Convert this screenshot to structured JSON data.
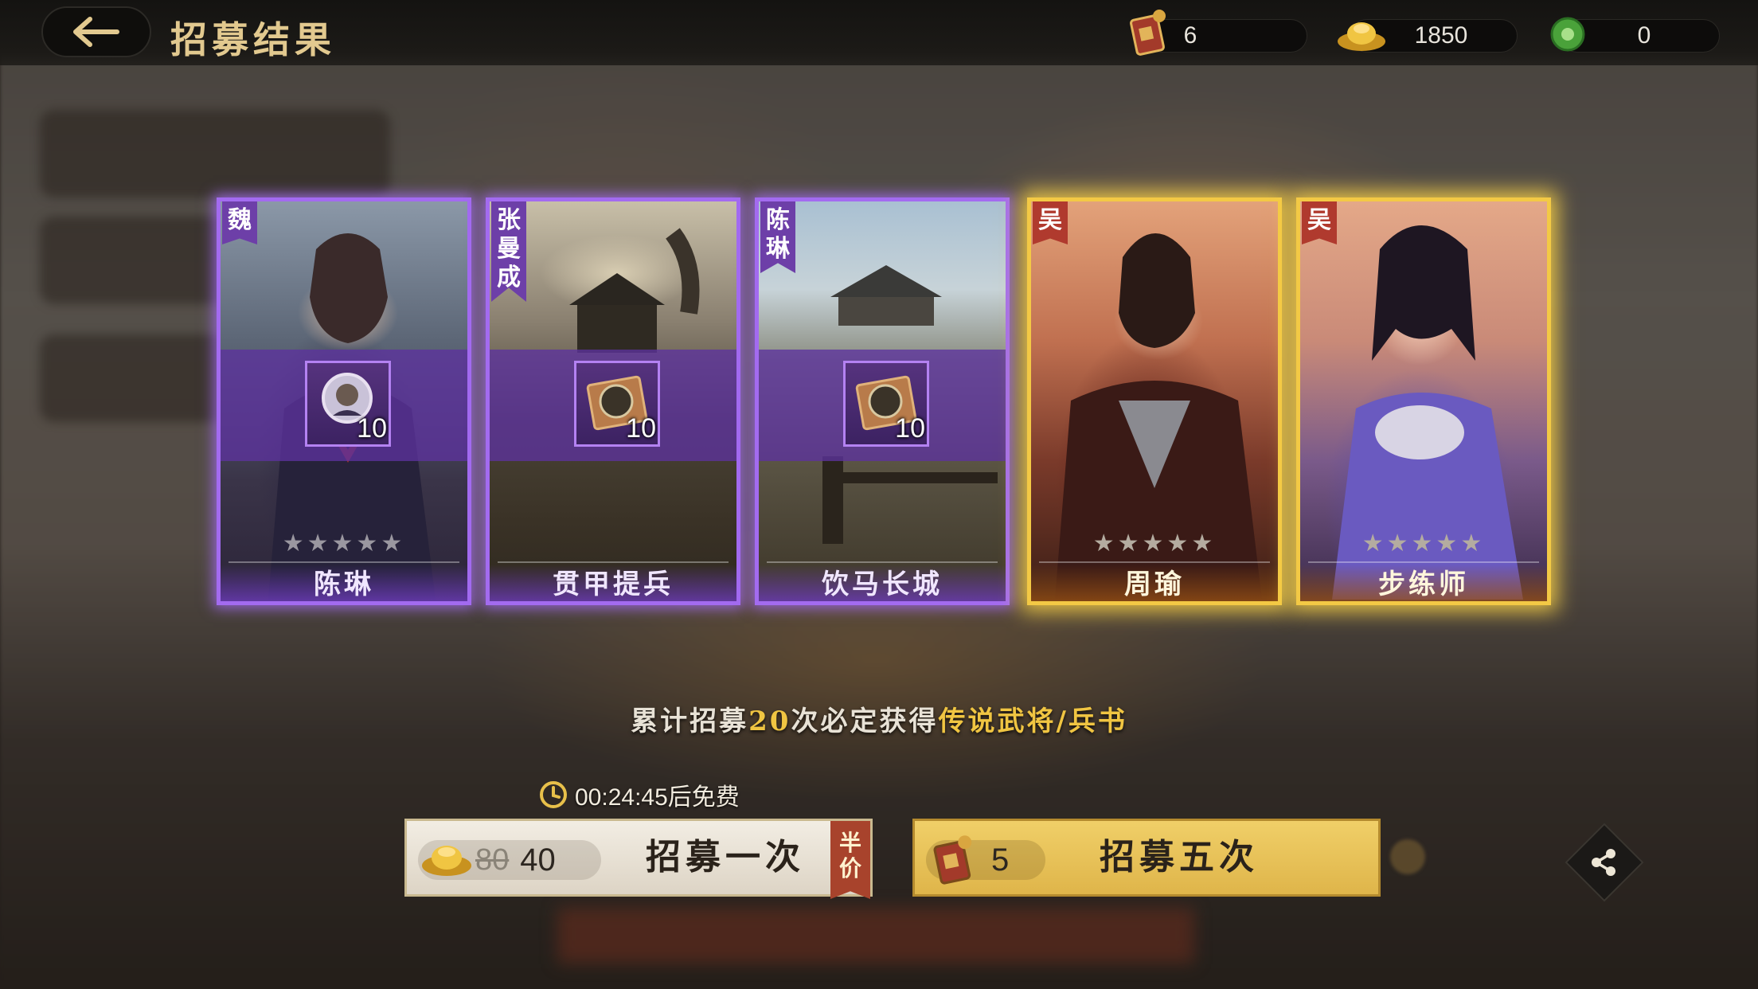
{
  "header": {
    "title": "招募结果",
    "resources": [
      {
        "icon": "recruit-token-icon",
        "value": "6"
      },
      {
        "icon": "gold-ingot-icon",
        "value": "1850"
      },
      {
        "icon": "jade-coin-icon",
        "value": "0"
      }
    ]
  },
  "cards": [
    {
      "name": "陈琳",
      "faction": "魏",
      "rarity": "purple",
      "item_count": "10",
      "stars": "★★★★★"
    },
    {
      "name": "贯甲提兵",
      "faction": "张曼成",
      "rarity": "purple",
      "item_count": "10",
      "stars": ""
    },
    {
      "name": "饮马长城",
      "faction": "陈琳",
      "rarity": "purple",
      "item_count": "10",
      "stars": ""
    },
    {
      "name": "周瑜",
      "faction": "吴",
      "rarity": "gold",
      "item_count": "",
      "stars": "★★★★★"
    },
    {
      "name": "步练师",
      "faction": "吴",
      "rarity": "gold",
      "item_count": "",
      "stars": "★★★★★"
    }
  ],
  "guarantee": {
    "prefix": "累计招募",
    "count": "20",
    "middle": "次必定获得",
    "reward": "传说武将/兵书"
  },
  "timer": {
    "text": "00:24:45后免费"
  },
  "recruit_once": {
    "old_cost": "80",
    "cost": "40",
    "label": "招募一次",
    "tag": "半价"
  },
  "recruit_five": {
    "cost": "5",
    "label": "招募五次"
  },
  "colors": {
    "gold_text": "#e2c98f",
    "highlight": "#f0c542",
    "purple_border": "#a36bf0",
    "gold_border": "#f3c945"
  }
}
